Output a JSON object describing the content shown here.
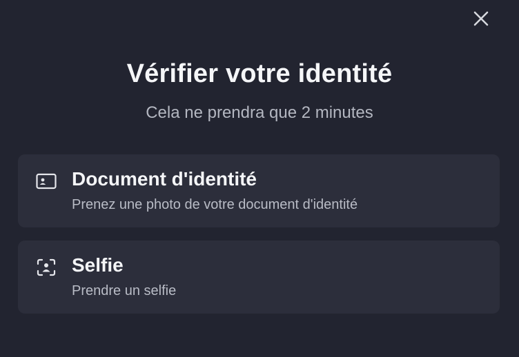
{
  "dialog": {
    "title": "Vérifier votre identité",
    "subtitle": "Cela ne prendra que 2 minutes",
    "close_icon": "close-icon"
  },
  "options": [
    {
      "icon": "id-card-icon",
      "title": "Document d'identité",
      "description": "Prenez une photo de votre document d'identité"
    },
    {
      "icon": "face-scan-icon",
      "title": "Selfie",
      "description": "Prendre un selfie"
    }
  ],
  "colors": {
    "background": "#222430",
    "card": "#2c2e3b",
    "text_primary": "#f4f5f7",
    "text_secondary": "#b9bcc6"
  }
}
